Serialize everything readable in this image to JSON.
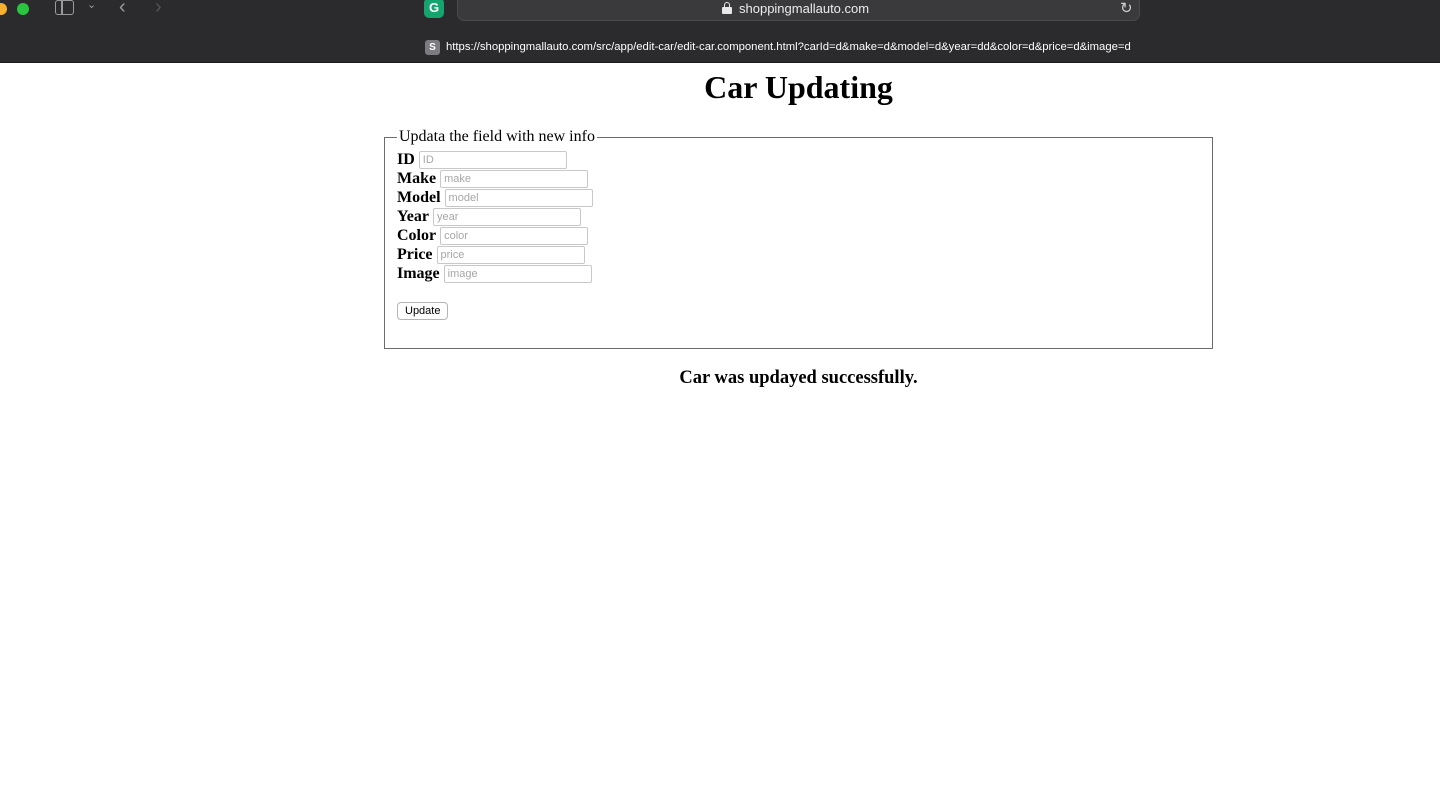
{
  "browser": {
    "domain": "shoppingmallauto.com",
    "url": "https://shoppingmallauto.com/src/app/edit-car/edit-car.component.html?carId=d&make=d&model=d&year=dd&color=d&price=d&image=d",
    "favicon_letter": "S",
    "extension_letter": "G"
  },
  "page": {
    "title": "Car Updating",
    "legend": "Updata the field with new info",
    "fields": [
      {
        "label": "ID",
        "placeholder": "ID",
        "value": ""
      },
      {
        "label": "Make",
        "placeholder": "make",
        "value": ""
      },
      {
        "label": "Model",
        "placeholder": "model",
        "value": ""
      },
      {
        "label": "Year",
        "placeholder": "year",
        "value": ""
      },
      {
        "label": "Color",
        "placeholder": "color",
        "value": ""
      },
      {
        "label": "Price",
        "placeholder": "price",
        "value": ""
      },
      {
        "label": "Image",
        "placeholder": "image",
        "value": ""
      }
    ],
    "update_button": "Update",
    "status_message": "Car was updayed successfully."
  }
}
